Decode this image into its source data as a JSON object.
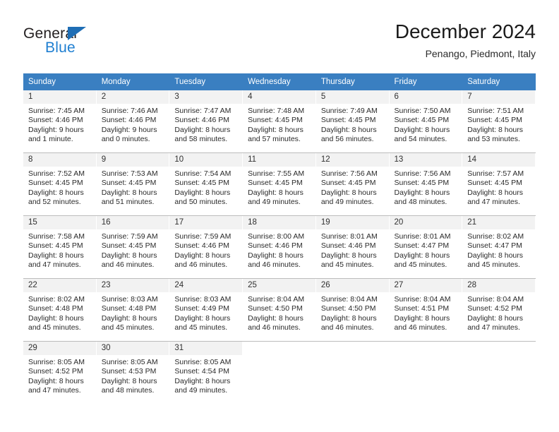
{
  "brand": {
    "name_part1": "General",
    "name_part2": "Blue",
    "triangle_color": "#1f6eb5",
    "blue_color": "#1f7fd1"
  },
  "header": {
    "title": "December 2024",
    "subtitle": "Penango, Piedmont, Italy"
  },
  "theme": {
    "header_bg": "#3a7fc1",
    "header_text": "#ffffff",
    "daynum_bg": "#f2f2f2",
    "cell_border": "#bcbcbc"
  },
  "weekdays": [
    "Sunday",
    "Monday",
    "Tuesday",
    "Wednesday",
    "Thursday",
    "Friday",
    "Saturday"
  ],
  "labels": {
    "sunrise_prefix": "Sunrise: ",
    "sunset_prefix": "Sunset: ",
    "daylight_prefix": "Daylight: "
  },
  "weeks": [
    [
      {
        "day": "1",
        "sunrise": "Sunrise: 7:45 AM",
        "sunset": "Sunset: 4:46 PM",
        "daylight_line1": "Daylight: 9 hours",
        "daylight_line2": "and 1 minute."
      },
      {
        "day": "2",
        "sunrise": "Sunrise: 7:46 AM",
        "sunset": "Sunset: 4:46 PM",
        "daylight_line1": "Daylight: 9 hours",
        "daylight_line2": "and 0 minutes."
      },
      {
        "day": "3",
        "sunrise": "Sunrise: 7:47 AM",
        "sunset": "Sunset: 4:46 PM",
        "daylight_line1": "Daylight: 8 hours",
        "daylight_line2": "and 58 minutes."
      },
      {
        "day": "4",
        "sunrise": "Sunrise: 7:48 AM",
        "sunset": "Sunset: 4:45 PM",
        "daylight_line1": "Daylight: 8 hours",
        "daylight_line2": "and 57 minutes."
      },
      {
        "day": "5",
        "sunrise": "Sunrise: 7:49 AM",
        "sunset": "Sunset: 4:45 PM",
        "daylight_line1": "Daylight: 8 hours",
        "daylight_line2": "and 56 minutes."
      },
      {
        "day": "6",
        "sunrise": "Sunrise: 7:50 AM",
        "sunset": "Sunset: 4:45 PM",
        "daylight_line1": "Daylight: 8 hours",
        "daylight_line2": "and 54 minutes."
      },
      {
        "day": "7",
        "sunrise": "Sunrise: 7:51 AM",
        "sunset": "Sunset: 4:45 PM",
        "daylight_line1": "Daylight: 8 hours",
        "daylight_line2": "and 53 minutes."
      }
    ],
    [
      {
        "day": "8",
        "sunrise": "Sunrise: 7:52 AM",
        "sunset": "Sunset: 4:45 PM",
        "daylight_line1": "Daylight: 8 hours",
        "daylight_line2": "and 52 minutes."
      },
      {
        "day": "9",
        "sunrise": "Sunrise: 7:53 AM",
        "sunset": "Sunset: 4:45 PM",
        "daylight_line1": "Daylight: 8 hours",
        "daylight_line2": "and 51 minutes."
      },
      {
        "day": "10",
        "sunrise": "Sunrise: 7:54 AM",
        "sunset": "Sunset: 4:45 PM",
        "daylight_line1": "Daylight: 8 hours",
        "daylight_line2": "and 50 minutes."
      },
      {
        "day": "11",
        "sunrise": "Sunrise: 7:55 AM",
        "sunset": "Sunset: 4:45 PM",
        "daylight_line1": "Daylight: 8 hours",
        "daylight_line2": "and 49 minutes."
      },
      {
        "day": "12",
        "sunrise": "Sunrise: 7:56 AM",
        "sunset": "Sunset: 4:45 PM",
        "daylight_line1": "Daylight: 8 hours",
        "daylight_line2": "and 49 minutes."
      },
      {
        "day": "13",
        "sunrise": "Sunrise: 7:56 AM",
        "sunset": "Sunset: 4:45 PM",
        "daylight_line1": "Daylight: 8 hours",
        "daylight_line2": "and 48 minutes."
      },
      {
        "day": "14",
        "sunrise": "Sunrise: 7:57 AM",
        "sunset": "Sunset: 4:45 PM",
        "daylight_line1": "Daylight: 8 hours",
        "daylight_line2": "and 47 minutes."
      }
    ],
    [
      {
        "day": "15",
        "sunrise": "Sunrise: 7:58 AM",
        "sunset": "Sunset: 4:45 PM",
        "daylight_line1": "Daylight: 8 hours",
        "daylight_line2": "and 47 minutes."
      },
      {
        "day": "16",
        "sunrise": "Sunrise: 7:59 AM",
        "sunset": "Sunset: 4:45 PM",
        "daylight_line1": "Daylight: 8 hours",
        "daylight_line2": "and 46 minutes."
      },
      {
        "day": "17",
        "sunrise": "Sunrise: 7:59 AM",
        "sunset": "Sunset: 4:46 PM",
        "daylight_line1": "Daylight: 8 hours",
        "daylight_line2": "and 46 minutes."
      },
      {
        "day": "18",
        "sunrise": "Sunrise: 8:00 AM",
        "sunset": "Sunset: 4:46 PM",
        "daylight_line1": "Daylight: 8 hours",
        "daylight_line2": "and 46 minutes."
      },
      {
        "day": "19",
        "sunrise": "Sunrise: 8:01 AM",
        "sunset": "Sunset: 4:46 PM",
        "daylight_line1": "Daylight: 8 hours",
        "daylight_line2": "and 45 minutes."
      },
      {
        "day": "20",
        "sunrise": "Sunrise: 8:01 AM",
        "sunset": "Sunset: 4:47 PM",
        "daylight_line1": "Daylight: 8 hours",
        "daylight_line2": "and 45 minutes."
      },
      {
        "day": "21",
        "sunrise": "Sunrise: 8:02 AM",
        "sunset": "Sunset: 4:47 PM",
        "daylight_line1": "Daylight: 8 hours",
        "daylight_line2": "and 45 minutes."
      }
    ],
    [
      {
        "day": "22",
        "sunrise": "Sunrise: 8:02 AM",
        "sunset": "Sunset: 4:48 PM",
        "daylight_line1": "Daylight: 8 hours",
        "daylight_line2": "and 45 minutes."
      },
      {
        "day": "23",
        "sunrise": "Sunrise: 8:03 AM",
        "sunset": "Sunset: 4:48 PM",
        "daylight_line1": "Daylight: 8 hours",
        "daylight_line2": "and 45 minutes."
      },
      {
        "day": "24",
        "sunrise": "Sunrise: 8:03 AM",
        "sunset": "Sunset: 4:49 PM",
        "daylight_line1": "Daylight: 8 hours",
        "daylight_line2": "and 45 minutes."
      },
      {
        "day": "25",
        "sunrise": "Sunrise: 8:04 AM",
        "sunset": "Sunset: 4:50 PM",
        "daylight_line1": "Daylight: 8 hours",
        "daylight_line2": "and 46 minutes."
      },
      {
        "day": "26",
        "sunrise": "Sunrise: 8:04 AM",
        "sunset": "Sunset: 4:50 PM",
        "daylight_line1": "Daylight: 8 hours",
        "daylight_line2": "and 46 minutes."
      },
      {
        "day": "27",
        "sunrise": "Sunrise: 8:04 AM",
        "sunset": "Sunset: 4:51 PM",
        "daylight_line1": "Daylight: 8 hours",
        "daylight_line2": "and 46 minutes."
      },
      {
        "day": "28",
        "sunrise": "Sunrise: 8:04 AM",
        "sunset": "Sunset: 4:52 PM",
        "daylight_line1": "Daylight: 8 hours",
        "daylight_line2": "and 47 minutes."
      }
    ],
    [
      {
        "day": "29",
        "sunrise": "Sunrise: 8:05 AM",
        "sunset": "Sunset: 4:52 PM",
        "daylight_line1": "Daylight: 8 hours",
        "daylight_line2": "and 47 minutes."
      },
      {
        "day": "30",
        "sunrise": "Sunrise: 8:05 AM",
        "sunset": "Sunset: 4:53 PM",
        "daylight_line1": "Daylight: 8 hours",
        "daylight_line2": "and 48 minutes."
      },
      {
        "day": "31",
        "sunrise": "Sunrise: 8:05 AM",
        "sunset": "Sunset: 4:54 PM",
        "daylight_line1": "Daylight: 8 hours",
        "daylight_line2": "and 49 minutes."
      },
      {
        "day": "",
        "sunrise": "",
        "sunset": "",
        "daylight_line1": "",
        "daylight_line2": ""
      },
      {
        "day": "",
        "sunrise": "",
        "sunset": "",
        "daylight_line1": "",
        "daylight_line2": ""
      },
      {
        "day": "",
        "sunrise": "",
        "sunset": "",
        "daylight_line1": "",
        "daylight_line2": ""
      },
      {
        "day": "",
        "sunrise": "",
        "sunset": "",
        "daylight_line1": "",
        "daylight_line2": ""
      }
    ]
  ]
}
